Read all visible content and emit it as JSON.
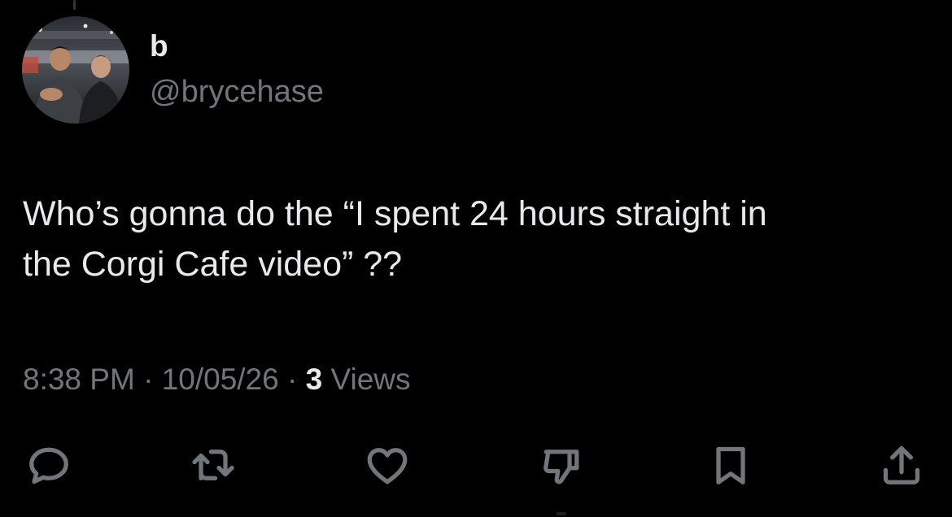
{
  "tweet": {
    "display_name": "b",
    "handle": "@brycehase",
    "text": "Who’s gonna do the “I spent 24 hours straight in\nthe Corgi Cafe video” ??",
    "time": "8:38 PM",
    "date": "10/05/26",
    "views_count": "3",
    "views_label": "Views",
    "separator": " · "
  },
  "actions": [
    {
      "icon": "reply-icon"
    },
    {
      "icon": "retweet-icon"
    },
    {
      "icon": "like-icon"
    },
    {
      "icon": "dislike-icon"
    },
    {
      "icon": "bookmark-icon"
    },
    {
      "icon": "share-icon"
    }
  ],
  "colors": {
    "background": "#000000",
    "primary_text": "#e7e9ea",
    "secondary_text": "#71767b"
  }
}
